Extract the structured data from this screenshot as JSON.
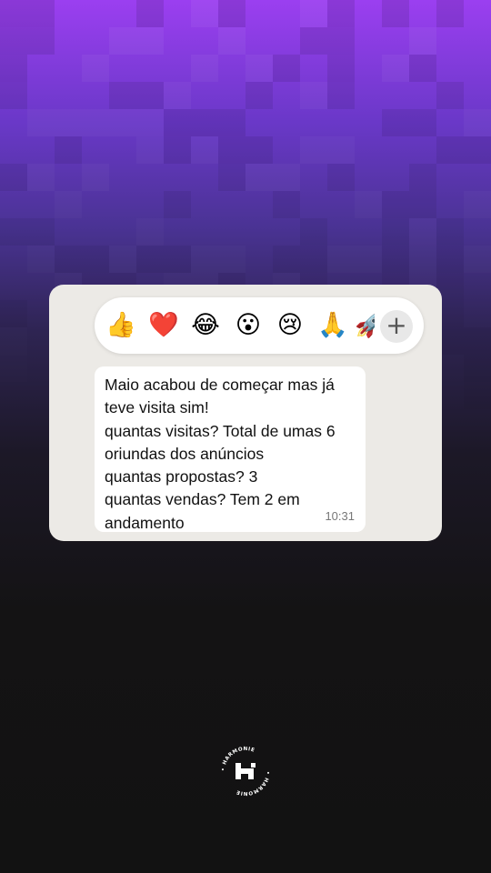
{
  "reactions": {
    "items": [
      {
        "name": "thumbs-up",
        "glyph": "👍"
      },
      {
        "name": "red-heart",
        "glyph": "❤️"
      },
      {
        "name": "tears-of-joy",
        "glyph": "😂"
      },
      {
        "name": "surprised-face",
        "glyph": "😮"
      },
      {
        "name": "crying-face",
        "glyph": "😢"
      },
      {
        "name": "folded-hands",
        "glyph": "🙏"
      },
      {
        "name": "rocket",
        "glyph": "🚀"
      }
    ],
    "more_label": "+"
  },
  "message": {
    "lines": [
      "Maio acabou de começar mas já",
      "teve visita sim!",
      "quantas visitas? Total de umas 6",
      "oriundas dos anúncios",
      "quantas propostas? 3",
      "quantas vendas? Tem 2 em",
      "andamento"
    ],
    "time": "10:31"
  },
  "brand": {
    "name": "HARMONIE"
  },
  "colors": {
    "gradient_top": "#9b3ff0",
    "background_bottom": "#121212",
    "card": "#eceae6",
    "bubble": "#ffffff"
  }
}
